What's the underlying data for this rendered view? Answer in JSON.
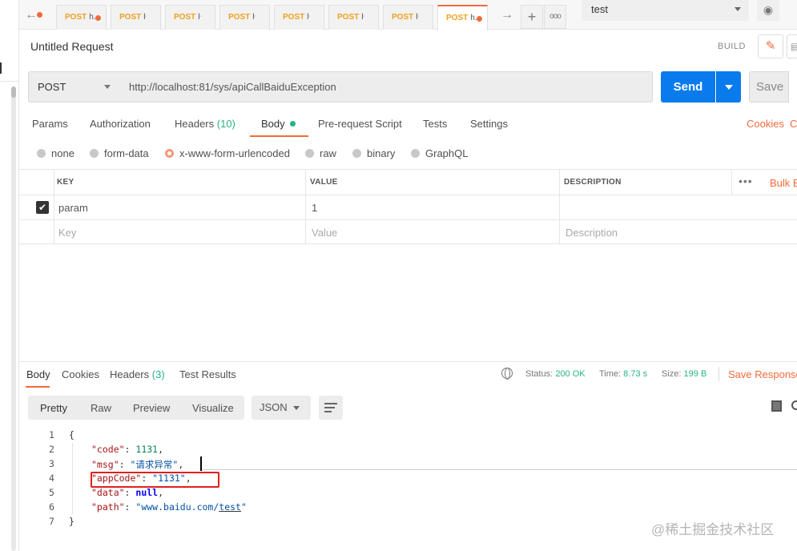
{
  "tabs": [
    {
      "method": "POST",
      "name": "h.",
      "unsaved": true,
      "active": false
    },
    {
      "method": "POST",
      "name": "ŀ",
      "unsaved": false,
      "active": false
    },
    {
      "method": "POST",
      "name": "ŀ",
      "unsaved": false,
      "active": false
    },
    {
      "method": "POST",
      "name": "ŀ",
      "unsaved": false,
      "active": false
    },
    {
      "method": "POST",
      "name": "ŀ",
      "unsaved": false,
      "active": false
    },
    {
      "method": "POST",
      "name": "ŀ",
      "unsaved": false,
      "active": false
    },
    {
      "method": "POST",
      "name": "ŀ",
      "unsaved": false,
      "active": false
    },
    {
      "method": "POST",
      "name": "h.",
      "unsaved": true,
      "active": true
    }
  ],
  "environment": {
    "selected": "test"
  },
  "request": {
    "title": "Untitled Request",
    "build_label": "BUILD",
    "method": "POST",
    "url": "http://localhost:81/sys/apiCallBaiduException",
    "send_label": "Send",
    "save_label": "Save"
  },
  "request_tabs": {
    "params": "Params",
    "authorization": "Authorization",
    "headers": "Headers",
    "headers_count": "(10)",
    "body": "Body",
    "prerequest": "Pre-request Script",
    "tests": "Tests",
    "settings": "Settings",
    "cookies": "Cookies",
    "code": "C"
  },
  "body_types": {
    "none": "none",
    "form_data": "form-data",
    "urlencoded": "x-www-form-urlencoded",
    "raw": "raw",
    "binary": "binary",
    "graphql": "GraphQL",
    "selected": "x-www-form-urlencoded"
  },
  "params_table": {
    "headers": {
      "key": "KEY",
      "value": "VALUE",
      "description": "DESCRIPTION"
    },
    "bulk_edit": "Bulk E",
    "rows": [
      {
        "checked": true,
        "key": "param",
        "value": "1",
        "description": ""
      }
    ],
    "placeholders": {
      "key": "Key",
      "value": "Value",
      "description": "Description"
    }
  },
  "response_tabs": {
    "body": "Body",
    "cookies": "Cookies",
    "headers": "Headers",
    "headers_count": "(3)",
    "test_results": "Test Results"
  },
  "response_status": {
    "status_label": "Status:",
    "status_value": "200 OK",
    "time_label": "Time:",
    "time_value": "8.73 s",
    "size_label": "Size:",
    "size_value": "199 B",
    "save_response": "Save Response"
  },
  "view_modes": {
    "pretty": "Pretty",
    "raw": "Raw",
    "preview": "Preview",
    "visualize": "Visualize",
    "format": "JSON"
  },
  "response_body": {
    "line_numbers": [
      "1",
      "2",
      "3",
      "4",
      "5",
      "6",
      "7"
    ],
    "open_brace": "{",
    "close_brace": "}",
    "fields": [
      {
        "key": "\"code\"",
        "value": "1131",
        "type": "number"
      },
      {
        "key": "\"msg\"",
        "value": "\"请求异常\"",
        "type": "string"
      },
      {
        "key": "\"appCode\"",
        "value": "\"1131\"",
        "type": "string"
      },
      {
        "key": "\"data\"",
        "value": "null",
        "type": "null"
      },
      {
        "key": "\"path\"",
        "value_a": "\"www.baidu.com/",
        "value_b": "test",
        "value_c": "\"",
        "type": "string"
      }
    ]
  },
  "watermark": "@稀土掘金技术社区",
  "colors": {
    "accent": "#f26b3a",
    "send": "#097bed",
    "success": "#26b47f",
    "highlight_box": "#e02020"
  }
}
